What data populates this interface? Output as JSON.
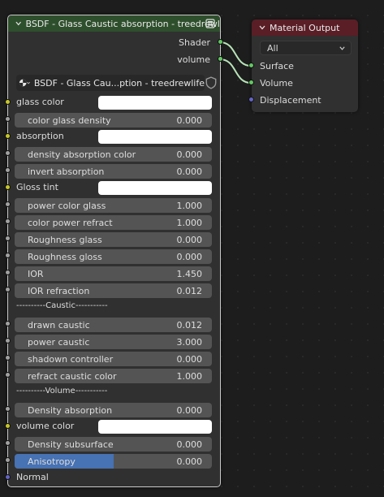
{
  "bsdf_node": {
    "title": "BSDF - Glass Caustic absorption - treedrewlife",
    "outputs": [
      "Shader",
      "volume"
    ],
    "datablock_name": "BSDF - Glass Cau...ption - treedrewlife",
    "inputs": [
      {
        "label": "glass color",
        "kind": "color"
      },
      {
        "label": "color glass density",
        "value": "0.000"
      },
      {
        "label": "absorption",
        "kind": "color"
      },
      {
        "label": "density absorption color",
        "value": "0.000"
      },
      {
        "label": "invert absorption",
        "value": "0.000"
      },
      {
        "label": "Gloss tint",
        "kind": "color"
      },
      {
        "label": "power color glass",
        "value": "1.000"
      },
      {
        "label": "color power refract",
        "value": "1.000"
      },
      {
        "label": "Roughness glass",
        "value": "0.000"
      },
      {
        "label": "Roughness gloss",
        "value": "0.000"
      },
      {
        "label": "IOR",
        "value": "1.450"
      },
      {
        "label": "IOR refraction",
        "value": "0.012"
      },
      {
        "label": "----------Caustic-----------",
        "kind": "separator"
      },
      {
        "label": "drawn caustic",
        "value": "0.012"
      },
      {
        "label": "power caustic",
        "value": "3.000"
      },
      {
        "label": "shadown controller",
        "value": "0.000"
      },
      {
        "label": "refract caustic color",
        "value": "1.000"
      },
      {
        "label": "----------Volume-----------",
        "kind": "separator"
      },
      {
        "label": "Density absorption",
        "value": "0.000"
      },
      {
        "label": "volume color",
        "kind": "color"
      },
      {
        "label": "Density subsurface",
        "value": "0.000"
      },
      {
        "label": "Anisotropy",
        "value": "0.000"
      },
      {
        "label": "Normal",
        "kind": "vector"
      }
    ]
  },
  "material_output": {
    "title": "Material Output",
    "target": "All",
    "inputs": [
      "Surface",
      "Volume",
      "Displacement"
    ]
  },
  "colors": {
    "bsdf_header": "#2e4f2c",
    "output_header": "#5a1e26",
    "socket_shader": "#63c763",
    "socket_color": "#c7c729",
    "socket_float": "#a1a1a1",
    "socket_vector": "#6363c7",
    "anisotropy_fill": "#4772b3"
  },
  "anisotropy_fill_fraction": 0.5
}
